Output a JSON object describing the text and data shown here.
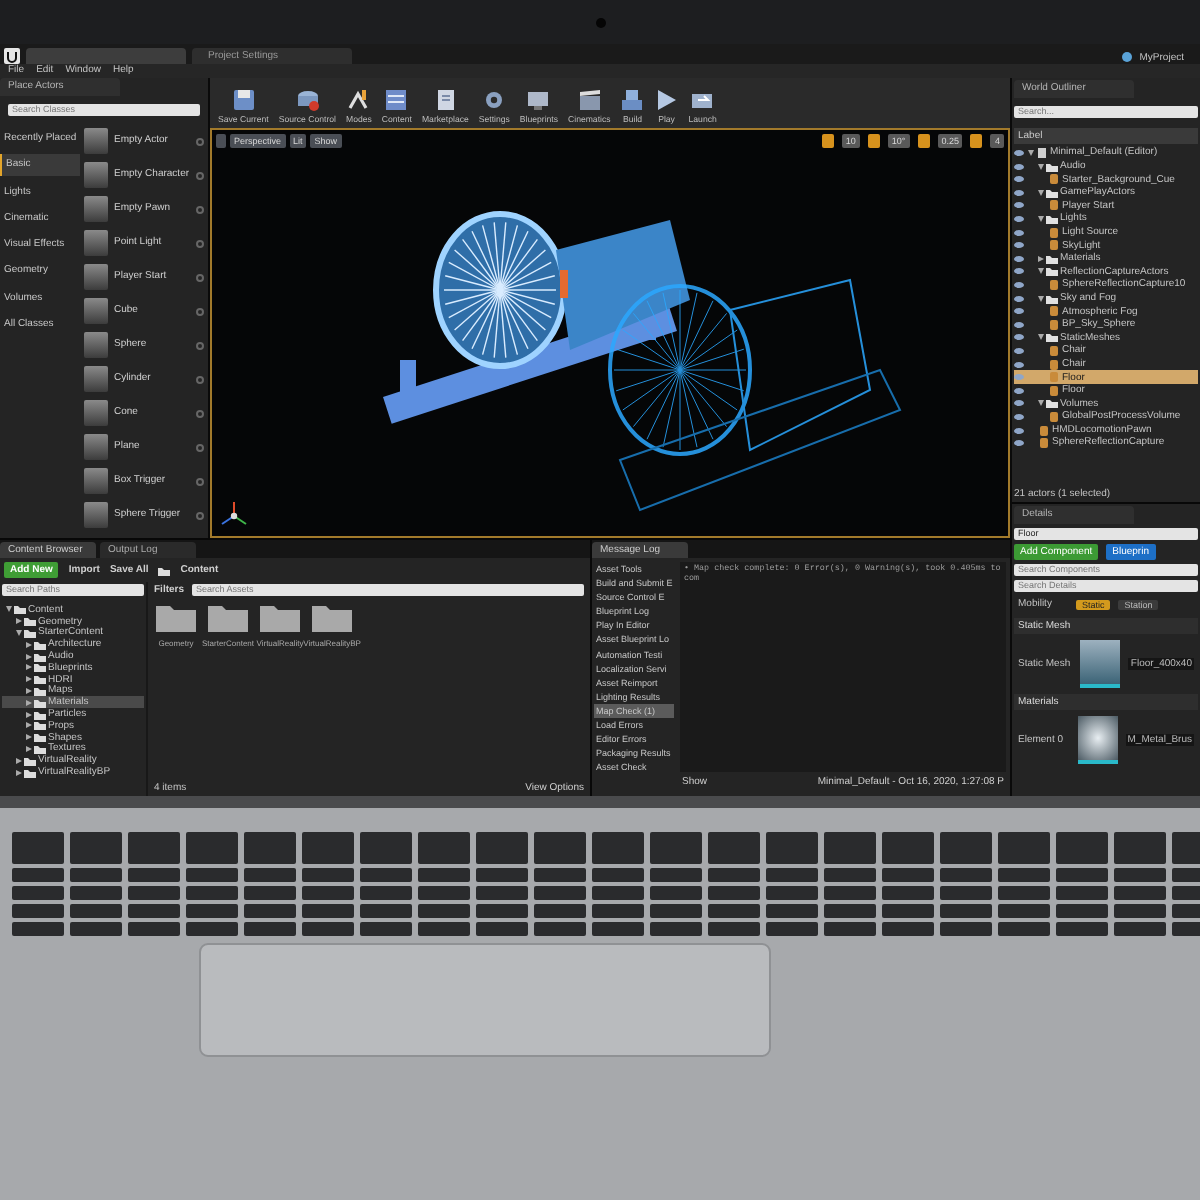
{
  "title_bar": {
    "tabs": [
      {
        "selected": true
      },
      {
        "label": "Project Settings",
        "selected": false
      }
    ],
    "project": "MyProject"
  },
  "menu": [
    "File",
    "Edit",
    "Window",
    "Help"
  ],
  "place_actors": {
    "title": "Place Actors",
    "search_placeholder": "Search Classes",
    "categories": [
      {
        "label": "Recently Placed",
        "selected": false
      },
      {
        "label": "Basic",
        "selected": true
      },
      {
        "label": "Lights",
        "selected": false
      },
      {
        "label": "Cinematic",
        "selected": false
      },
      {
        "label": "Visual Effects",
        "selected": false
      },
      {
        "label": "Geometry",
        "selected": false
      },
      {
        "label": "Volumes",
        "selected": false
      },
      {
        "label": "All Classes",
        "selected": false
      }
    ],
    "items": [
      "Empty Actor",
      "Empty Character",
      "Empty Pawn",
      "Point Light",
      "Player Start",
      "Cube",
      "Sphere",
      "Cylinder",
      "Cone",
      "Plane",
      "Box Trigger",
      "Sphere Trigger"
    ]
  },
  "toolbar": [
    {
      "label": "Save Current",
      "kind": "save"
    },
    {
      "label": "Source Control",
      "kind": "source"
    },
    {
      "label": "Modes",
      "kind": "modes"
    },
    {
      "label": "Content",
      "kind": "content"
    },
    {
      "label": "Marketplace",
      "kind": "market"
    },
    {
      "label": "Settings",
      "kind": "settings"
    },
    {
      "label": "Blueprints",
      "kind": "blueprints"
    },
    {
      "label": "Cinematics",
      "kind": "cinematics"
    },
    {
      "label": "Build",
      "kind": "build"
    },
    {
      "label": "Play",
      "kind": "play"
    },
    {
      "label": "Launch",
      "kind": "launch"
    }
  ],
  "viewport": {
    "buttons": [
      "Perspective",
      "Lit",
      "Show"
    ],
    "snap_values": [
      "10",
      "10°",
      "0.25",
      "4"
    ]
  },
  "outliner": {
    "title": "World Outliner",
    "search_placeholder": "Search...",
    "column": "Label",
    "footer": "21 actors (1 selected)",
    "tree": [
      {
        "label": "Minimal_Default (Editor)",
        "kind": "level",
        "expanded": true,
        "selected": false,
        "children": [
          {
            "label": "Audio",
            "kind": "folder",
            "expanded": true,
            "selected": false,
            "children": [
              {
                "label": "Starter_Background_Cue",
                "kind": "actor",
                "selected": false
              }
            ]
          },
          {
            "label": "GamePlayActors",
            "kind": "folder",
            "expanded": true,
            "selected": false,
            "children": [
              {
                "label": "Player Start",
                "kind": "actor",
                "selected": false
              }
            ]
          },
          {
            "label": "Lights",
            "kind": "folder",
            "expanded": true,
            "selected": false,
            "children": [
              {
                "label": "Light Source",
                "kind": "actor",
                "selected": false
              },
              {
                "label": "SkyLight",
                "kind": "actor",
                "selected": false
              }
            ]
          },
          {
            "label": "Materials",
            "kind": "folder",
            "expanded": false,
            "selected": false
          },
          {
            "label": "ReflectionCaptureActors",
            "kind": "folder",
            "expanded": true,
            "selected": false,
            "children": [
              {
                "label": "SphereReflectionCapture10",
                "kind": "actor",
                "selected": false
              }
            ]
          },
          {
            "label": "Sky and Fog",
            "kind": "folder",
            "expanded": true,
            "selected": false,
            "children": [
              {
                "label": "Atmospheric Fog",
                "kind": "actor",
                "selected": false
              },
              {
                "label": "BP_Sky_Sphere",
                "kind": "actor",
                "selected": false
              }
            ]
          },
          {
            "label": "StaticMeshes",
            "kind": "folder",
            "expanded": true,
            "selected": false,
            "children": [
              {
                "label": "Chair",
                "kind": "actor",
                "selected": false
              },
              {
                "label": "Chair",
                "kind": "actor",
                "selected": false
              },
              {
                "label": "Floor",
                "kind": "actor",
                "selected": true
              },
              {
                "label": "Floor",
                "kind": "actor",
                "selected": false
              }
            ]
          },
          {
            "label": "Volumes",
            "kind": "folder",
            "expanded": true,
            "selected": false,
            "children": [
              {
                "label": "GlobalPostProcessVolume",
                "kind": "actor",
                "selected": false
              }
            ]
          },
          {
            "label": "HMDLocomotionPawn",
            "kind": "actor",
            "selected": false
          },
          {
            "label": "SphereReflectionCapture",
            "kind": "actor",
            "selected": false
          }
        ]
      }
    ]
  },
  "details": {
    "title": "Details",
    "name_value": "Floor",
    "add_component": "Add Component",
    "blueprint": "Blueprin",
    "search_components": {
      "placeholder": "Search Components"
    },
    "search_details": {
      "placeholder": "Search Details"
    },
    "mobility_label": "Mobility",
    "mobility_options": [
      {
        "label": "Static",
        "selected": true
      },
      {
        "label": "Station",
        "selected": false
      }
    ],
    "sections": [
      {
        "title": "Static Mesh",
        "row_label": "Static Mesh",
        "asset": "Floor_400x40"
      },
      {
        "title": "Materials",
        "row_label": "Element 0",
        "asset": "M_Metal_Brus"
      }
    ]
  },
  "content_browser": {
    "tabs": [
      {
        "label": "Content Browser",
        "selected": true
      },
      {
        "label": "Output Log",
        "selected": false
      }
    ],
    "add_new": "Add New",
    "import": "Import",
    "save_all": "Save All",
    "path": "Content",
    "search_paths": {
      "placeholder": "Search Paths"
    },
    "filters": "Filters",
    "search_assets": {
      "placeholder": "Search Assets"
    },
    "tree": [
      {
        "label": "Content",
        "expanded": true,
        "selected": false,
        "children": [
          {
            "label": "Geometry",
            "expanded": false,
            "selected": false
          },
          {
            "label": "StarterContent",
            "expanded": true,
            "selected": false,
            "children": [
              {
                "label": "Architecture",
                "expanded": false,
                "selected": false
              },
              {
                "label": "Audio",
                "expanded": false,
                "selected": false
              },
              {
                "label": "Blueprints",
                "expanded": false,
                "selected": false
              },
              {
                "label": "HDRI",
                "expanded": false,
                "selected": false
              },
              {
                "label": "Maps",
                "expanded": false,
                "selected": false
              },
              {
                "label": "Materials",
                "expanded": false,
                "selected": true
              },
              {
                "label": "Particles",
                "expanded": false,
                "selected": false
              },
              {
                "label": "Props",
                "expanded": false,
                "selected": false
              },
              {
                "label": "Shapes",
                "expanded": false,
                "selected": false
              },
              {
                "label": "Textures",
                "expanded": false,
                "selected": false
              }
            ]
          },
          {
            "label": "VirtualReality",
            "expanded": false,
            "selected": false
          },
          {
            "label": "VirtualRealityBP",
            "expanded": false,
            "selected": false
          }
        ]
      }
    ],
    "folders": [
      "Geometry",
      "StarterContent",
      "VirtualReality",
      "VirtualRealityBP"
    ],
    "item_count": "4 items",
    "view_options": "View Options"
  },
  "message_log": {
    "title": "Message Log",
    "categories": [
      {
        "label": "Asset Tools",
        "selected": false
      },
      {
        "label": "Build and Submit E",
        "selected": false
      },
      {
        "label": "Source Control E",
        "selected": false
      },
      {
        "label": "Blueprint Log",
        "selected": false
      },
      {
        "label": "Play In Editor",
        "selected": false
      },
      {
        "label": "Asset Blueprint Lo",
        "selected": false
      },
      {
        "label": "Automation Testi",
        "selected": false
      },
      {
        "label": "Localization Servi",
        "selected": false
      },
      {
        "label": "Asset Reimport",
        "selected": false
      },
      {
        "label": "Lighting Results",
        "selected": false
      },
      {
        "label": "Map Check (1)",
        "selected": true
      },
      {
        "label": "Load Errors",
        "selected": false
      },
      {
        "label": "Editor Errors",
        "selected": false
      },
      {
        "label": "Packaging Results",
        "selected": false
      },
      {
        "label": "Asset Check",
        "selected": false
      }
    ],
    "lines": [
      "• Map check complete: 0 Error(s), 0 Warning(s), took 0.405ms to com"
    ],
    "show": "Show",
    "page": "Minimal_Default - Oct 16, 2020, 1:27:08 P"
  }
}
